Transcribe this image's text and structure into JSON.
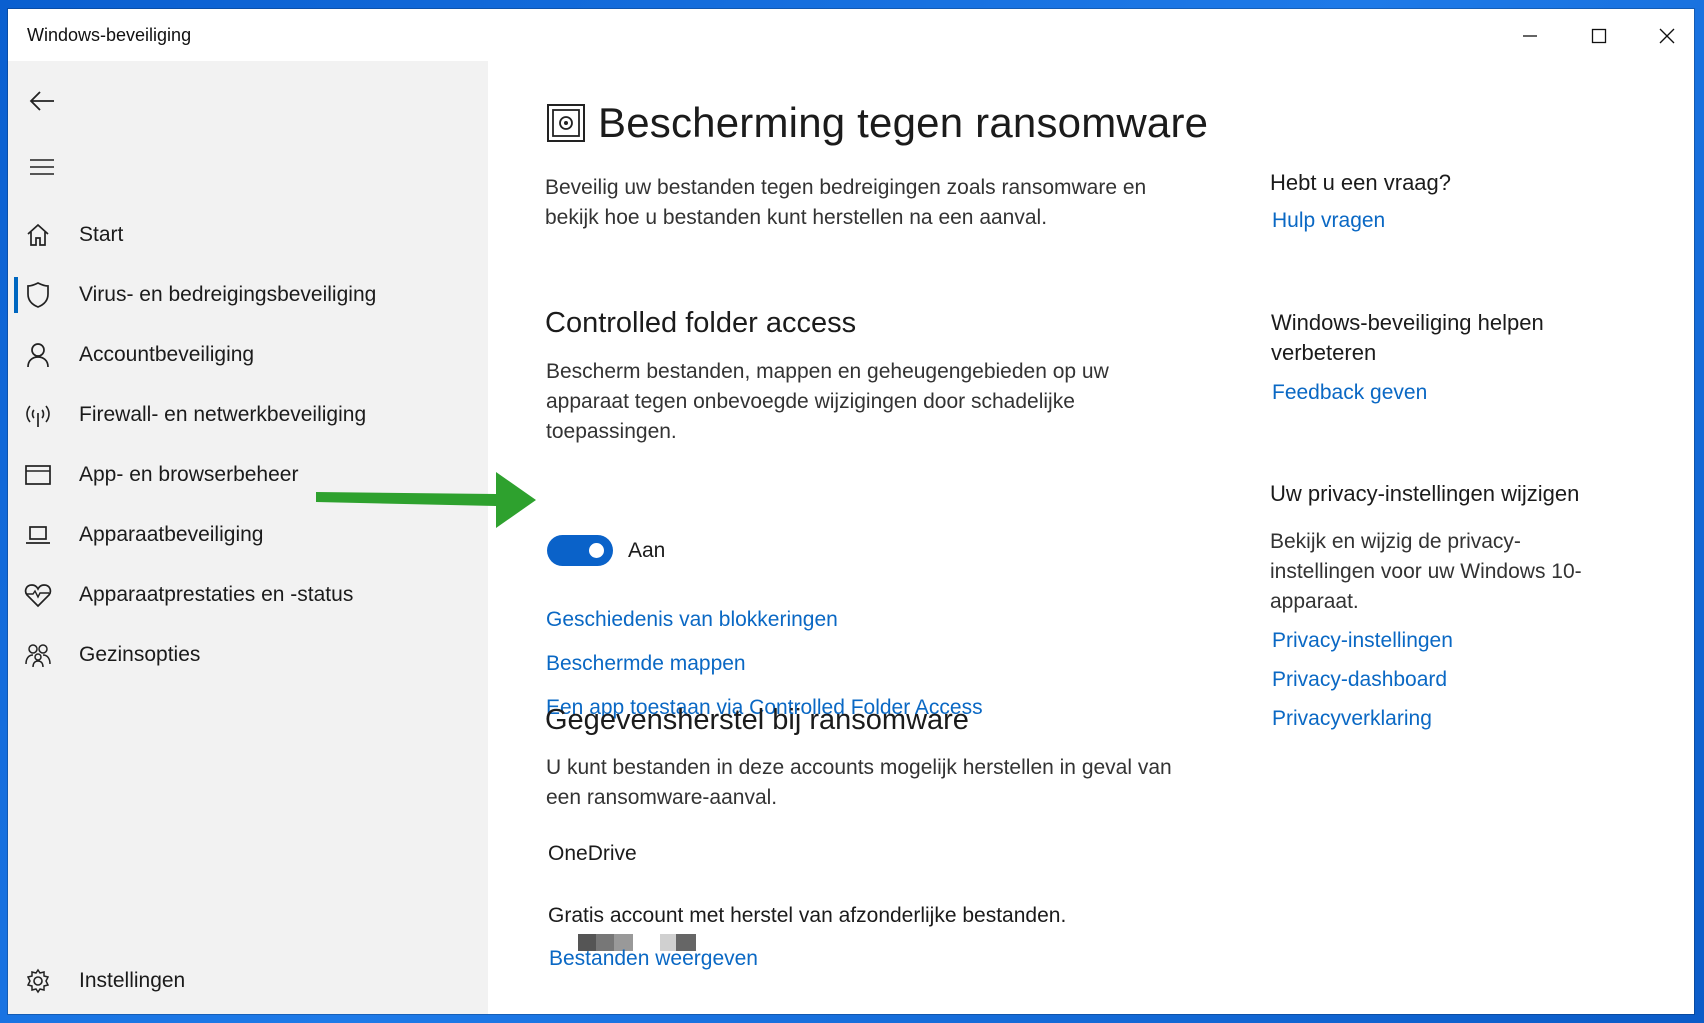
{
  "window": {
    "title": "Windows-beveiliging"
  },
  "sidebar": {
    "items": [
      {
        "label": "Start",
        "icon": "home-icon"
      },
      {
        "label": "Virus- en bedreigingsbeveiliging",
        "icon": "shield-icon",
        "active": true
      },
      {
        "label": "Accountbeveiliging",
        "icon": "person-icon"
      },
      {
        "label": "Firewall- en netwerkbeveiliging",
        "icon": "antenna-icon"
      },
      {
        "label": "App- en browserbeheer",
        "icon": "browser-window-icon"
      },
      {
        "label": "Apparaatbeveiliging",
        "icon": "laptop-icon"
      },
      {
        "label": "Apparaatprestaties en -status",
        "icon": "heart-pulse-icon"
      },
      {
        "label": "Gezinsopties",
        "icon": "family-icon"
      }
    ],
    "settings_label": "Instellingen"
  },
  "main": {
    "title": "Bescherming tegen ransomware",
    "intro": "Beveilig uw bestanden tegen bedreigingen zoals ransomware en bekijk hoe u bestanden kunt herstellen na een aanval.",
    "cfa": {
      "heading": "Controlled folder access",
      "description": "Bescherm bestanden, mappen en geheugengebieden op uw apparaat tegen onbevoegde wijzigingen door schadelijke toepassingen.",
      "toggle_on": true,
      "toggle_label": "Aan",
      "links": [
        "Geschiedenis van blokkeringen",
        "Beschermde mappen",
        "Een app toestaan via Controlled Folder Access"
      ]
    },
    "recovery": {
      "heading": "Gegevensherstel bij ransomware",
      "description": "U kunt bestanden in deze accounts mogelijk herstellen in geval van een ransomware-aanval.",
      "service": "OneDrive",
      "account_info": "Gratis account met herstel van afzonderlijke bestanden.",
      "link": "Bestanden weergeven"
    }
  },
  "right": {
    "question": {
      "heading": "Hebt u een vraag?",
      "link": "Hulp vragen"
    },
    "improve": {
      "heading": "Windows-beveiliging helpen verbeteren",
      "link": "Feedback geven"
    },
    "privacy": {
      "heading": "Uw privacy-instellingen wijzigen",
      "description": "Bekijk en wijzig de privacy-instellingen voor uw Windows 10-apparaat.",
      "links": [
        "Privacy-instellingen",
        "Privacy-dashboard",
        "Privacyverklaring"
      ]
    }
  },
  "colors": {
    "accent": "#0a68c4",
    "toggle": "#0a62c9",
    "arrow": "#2ea12e"
  }
}
